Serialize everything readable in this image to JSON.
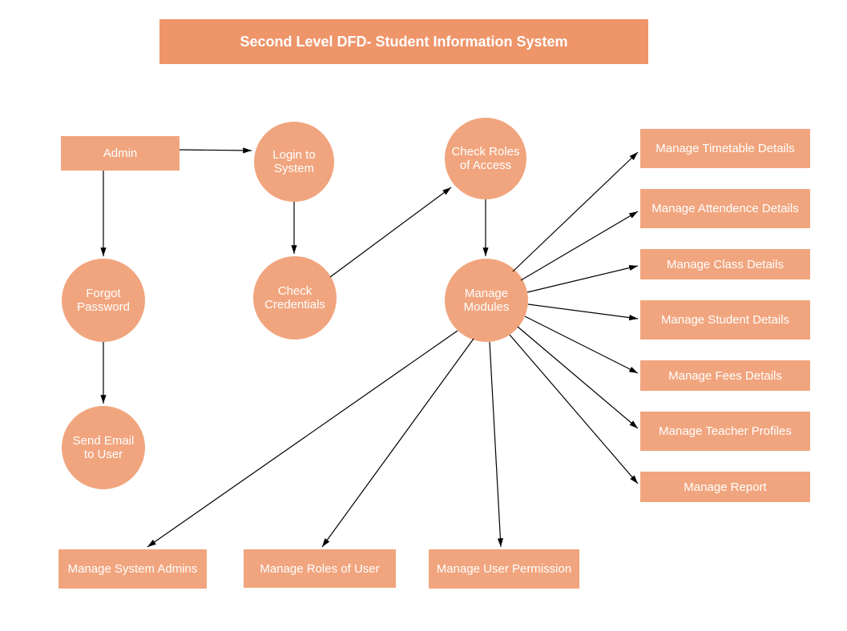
{
  "title": "Second Level DFD- Student Information System",
  "nodes": {
    "admin": "Admin",
    "login": "Login to System",
    "check_roles": "Check Roles of Access",
    "forgot_password": "Forgot Password",
    "check_credentials": "Check Credentials",
    "manage_modules": "Manage Modules",
    "send_email": "Send Email to User",
    "manage_system_admins": "Manage System Admins",
    "manage_roles_user": "Manage Roles of User",
    "manage_user_permission": "Manage User Permission",
    "manage_timetable": "Manage Timetable Details",
    "manage_attendance": "Manage Attendence Details",
    "manage_class": "Manage Class Details",
    "manage_student": "Manage Student Details",
    "manage_fees": "Manage Fees Details",
    "manage_teacher": "Manage Teacher Profiles",
    "manage_report": "Manage Report"
  },
  "colors": {
    "title_bg": "#ee956a",
    "node_bg": "#f1a57e",
    "text": "#ffffff",
    "arrow": "#000000"
  }
}
